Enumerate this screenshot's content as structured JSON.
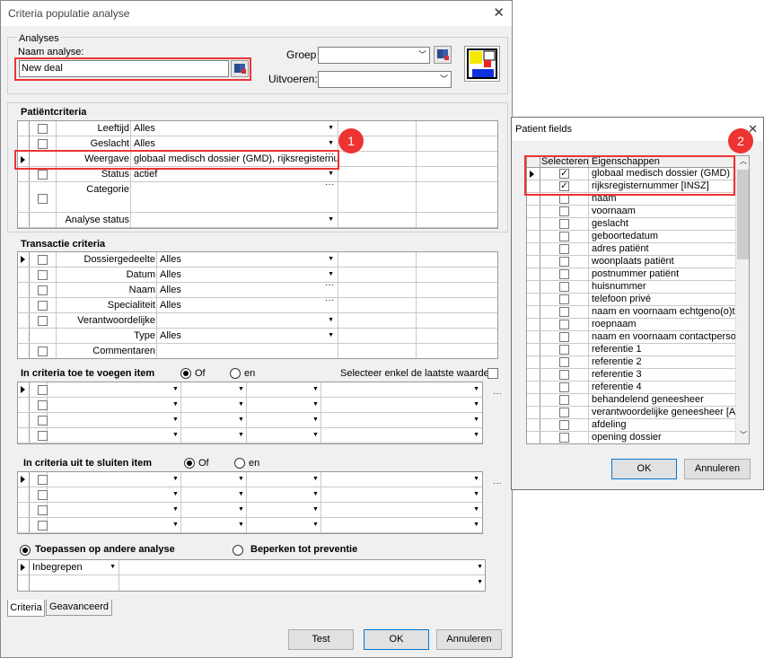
{
  "main": {
    "title": "Criteria populatie analyse",
    "analyses_group": "Analyses",
    "naam_label": "Naam analyse:",
    "naam_value": "New deal",
    "groep_label": "Groep",
    "uitvoeren_label": "Uitvoeren:",
    "patient_title": "Patiëntcriteria",
    "patient_rows": [
      {
        "label": "Leeftijd",
        "value": "Alles",
        "ctrl": "dd"
      },
      {
        "label": "Geslacht",
        "value": "Alles",
        "ctrl": "dd"
      },
      {
        "label": "Weergave",
        "value": "globaal medisch dossier (GMD), rijksregisternu",
        "ctrl": "dots"
      },
      {
        "label": "Status",
        "value": "actief",
        "ctrl": "dd"
      },
      {
        "label": "Categorie",
        "value": "",
        "ctrl": "dots"
      },
      {
        "label": "Analyse status",
        "value": "",
        "ctrl": "dd"
      }
    ],
    "transactie_title": "Transactie criteria",
    "transactie_rows": [
      {
        "label": "Dossiergedeelte",
        "value": "Alles",
        "ctrl": "dd"
      },
      {
        "label": "Datum",
        "value": "Alles",
        "ctrl": "dd"
      },
      {
        "label": "Naam",
        "value": "Alles",
        "ctrl": "dots"
      },
      {
        "label": "Specialiteit",
        "value": "Alles",
        "ctrl": "dots"
      },
      {
        "label": "Verantwoordelijke",
        "value": "",
        "ctrl": "dd"
      },
      {
        "label": "Type",
        "value": "Alles",
        "ctrl": "dd"
      },
      {
        "label": "Commentaren",
        "value": "",
        "ctrl": "none"
      }
    ],
    "toevoegen_title": "In criteria toe te voegen item",
    "uitsluiten_title": "In criteria uit te sluiten item",
    "of_label": "Of",
    "en_label": "en",
    "laatste_waarde": "Selecteer enkel de laatste waarde",
    "toepassen_label": "Toepassen op andere analyse",
    "beperken_label": "Beperken tot preventie",
    "inbegrepen": "Inbegrepen",
    "tab_criteria": "Criteria",
    "tab_geavanceerd": "Geavanceerd",
    "btn_test": "Test",
    "btn_ok": "OK",
    "btn_annuleren": "Annuleren"
  },
  "patient_fields": {
    "title": "Patient fields",
    "col_select": "Selecteren",
    "col_props": "Eigenschappen",
    "rows": [
      {
        "name": "globaal medisch dossier (GMD)",
        "checked": true
      },
      {
        "name": "rijksregisternummer [INSZ]",
        "checked": true
      },
      {
        "name": "naam",
        "checked": false
      },
      {
        "name": "voornaam",
        "checked": false
      },
      {
        "name": "geslacht",
        "checked": false
      },
      {
        "name": "geboortedatum",
        "checked": false
      },
      {
        "name": "adres patiënt",
        "checked": false
      },
      {
        "name": "woonplaats patiënt",
        "checked": false
      },
      {
        "name": "postnummer patiënt",
        "checked": false
      },
      {
        "name": "huisnummer",
        "checked": false
      },
      {
        "name": "telefoon privé",
        "checked": false
      },
      {
        "name": "naam en voornaam echtgeno(o)te",
        "checked": false
      },
      {
        "name": "roepnaam",
        "checked": false
      },
      {
        "name": "naam en voornaam contactpersoon",
        "checked": false
      },
      {
        "name": "referentie 1",
        "checked": false
      },
      {
        "name": "referentie 2",
        "checked": false
      },
      {
        "name": "referentie 3",
        "checked": false
      },
      {
        "name": "referentie 4",
        "checked": false
      },
      {
        "name": "behandelend geneesheer",
        "checked": false
      },
      {
        "name": "verantwoordelijke geneesheer [A]",
        "checked": false
      },
      {
        "name": "afdeling",
        "checked": false
      },
      {
        "name": "opening dossier",
        "checked": false
      }
    ],
    "btn_ok": "OK",
    "btn_annuleren": "Annuleren"
  },
  "annotations": {
    "badge1": "1",
    "badge2": "2",
    "accent": "#e33333"
  },
  "icons": [
    "close-icon",
    "book-icon",
    "layout-icon",
    "dropdown-arrow-icon",
    "ellipsis-icon",
    "row-pointer-icon",
    "checkbox-icon",
    "radio-icon"
  ]
}
